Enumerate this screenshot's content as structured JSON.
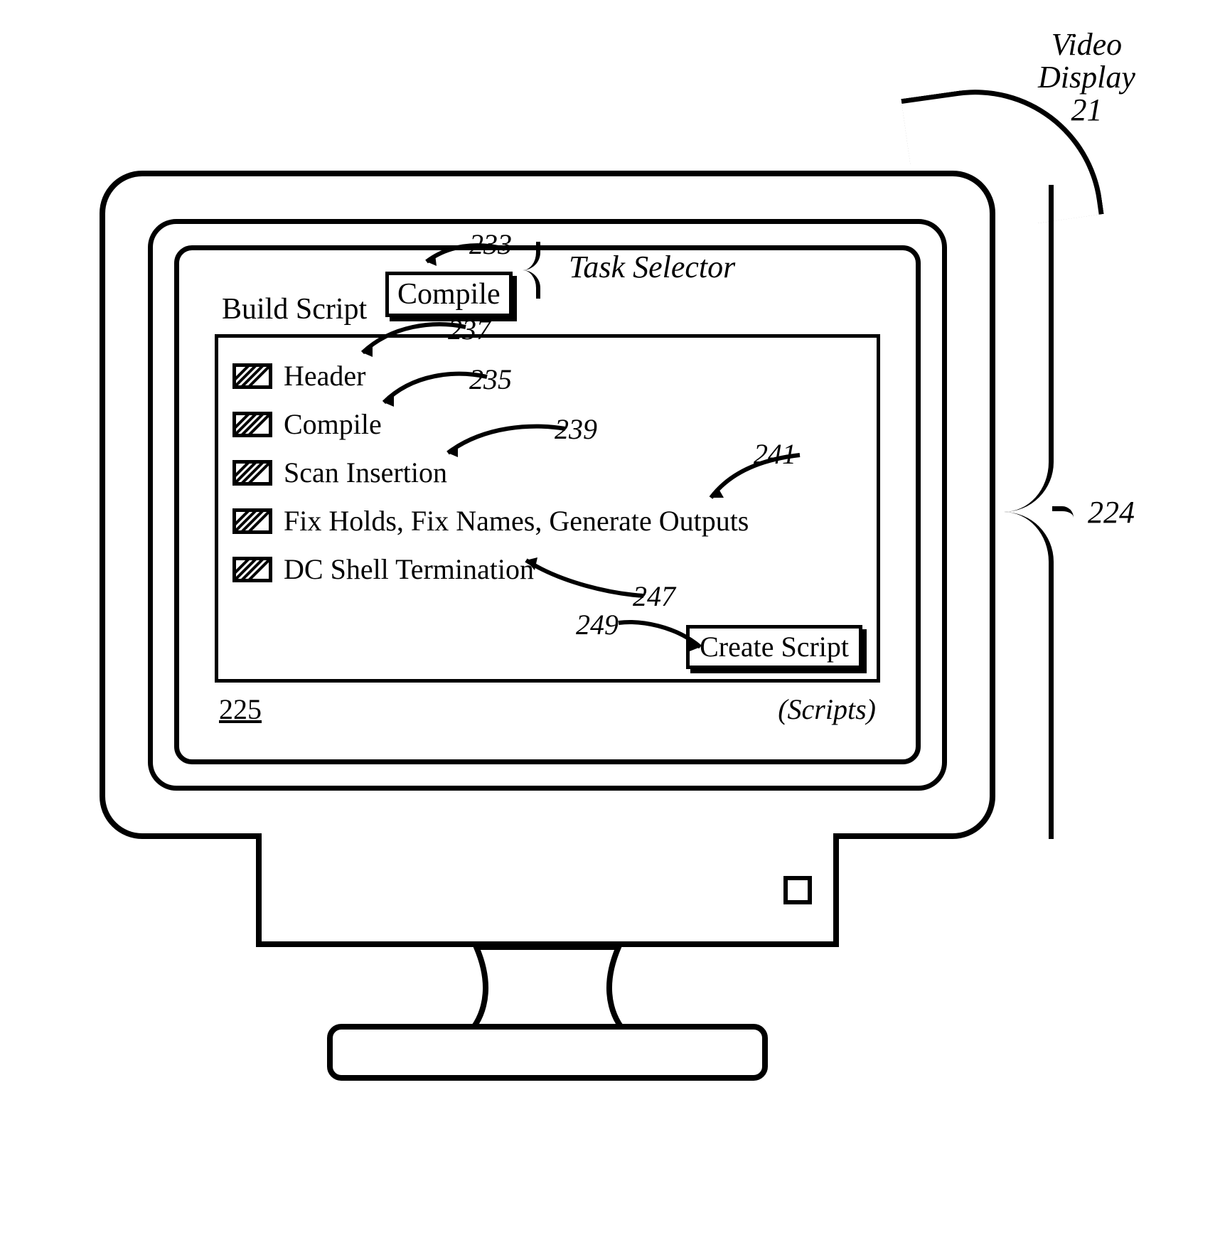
{
  "callouts": {
    "video_display": "Video\nDisplay\n21",
    "monitor_ref": "224",
    "task_selector": "Task Selector",
    "compile_ref": "233",
    "header_ref": "237",
    "compile_item_ref": "235",
    "scan_ref": "239",
    "fix_ref": "241",
    "dc_ref": "247",
    "create_ref": "249"
  },
  "screen": {
    "build_script_label": "Build Script",
    "compile_button": "Compile",
    "items": [
      {
        "label": "Header"
      },
      {
        "label": "Compile"
      },
      {
        "label": "Scan Insertion"
      },
      {
        "label": "Fix Holds, Fix Names, Generate Outputs"
      },
      {
        "label": "DC Shell Termination"
      }
    ],
    "create_button": "Create Script",
    "footer_left": "225",
    "footer_right": "(Scripts)"
  }
}
